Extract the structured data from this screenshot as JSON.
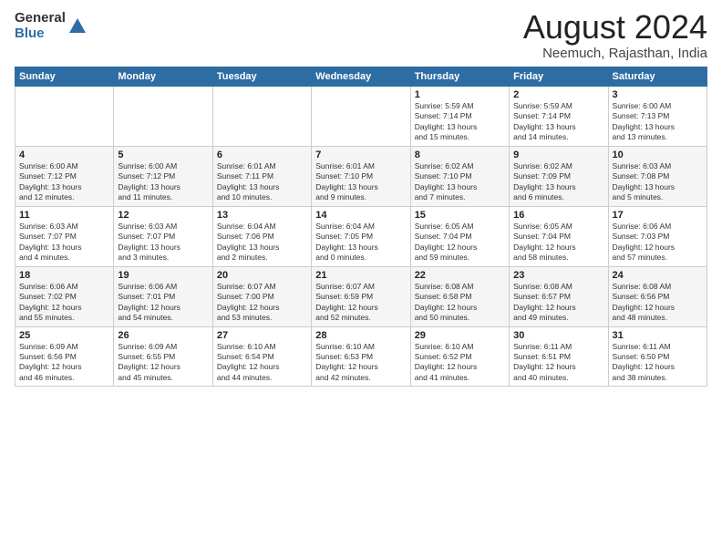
{
  "header": {
    "logo_general": "General",
    "logo_blue": "Blue",
    "month_title": "August 2024",
    "location": "Neemuch, Rajasthan, India"
  },
  "days_of_week": [
    "Sunday",
    "Monday",
    "Tuesday",
    "Wednesday",
    "Thursday",
    "Friday",
    "Saturday"
  ],
  "weeks": [
    [
      {
        "day": "",
        "info": ""
      },
      {
        "day": "",
        "info": ""
      },
      {
        "day": "",
        "info": ""
      },
      {
        "day": "",
        "info": ""
      },
      {
        "day": "1",
        "info": "Sunrise: 5:59 AM\nSunset: 7:14 PM\nDaylight: 13 hours\nand 15 minutes."
      },
      {
        "day": "2",
        "info": "Sunrise: 5:59 AM\nSunset: 7:14 PM\nDaylight: 13 hours\nand 14 minutes."
      },
      {
        "day": "3",
        "info": "Sunrise: 6:00 AM\nSunset: 7:13 PM\nDaylight: 13 hours\nand 13 minutes."
      }
    ],
    [
      {
        "day": "4",
        "info": "Sunrise: 6:00 AM\nSunset: 7:12 PM\nDaylight: 13 hours\nand 12 minutes."
      },
      {
        "day": "5",
        "info": "Sunrise: 6:00 AM\nSunset: 7:12 PM\nDaylight: 13 hours\nand 11 minutes."
      },
      {
        "day": "6",
        "info": "Sunrise: 6:01 AM\nSunset: 7:11 PM\nDaylight: 13 hours\nand 10 minutes."
      },
      {
        "day": "7",
        "info": "Sunrise: 6:01 AM\nSunset: 7:10 PM\nDaylight: 13 hours\nand 9 minutes."
      },
      {
        "day": "8",
        "info": "Sunrise: 6:02 AM\nSunset: 7:10 PM\nDaylight: 13 hours\nand 7 minutes."
      },
      {
        "day": "9",
        "info": "Sunrise: 6:02 AM\nSunset: 7:09 PM\nDaylight: 13 hours\nand 6 minutes."
      },
      {
        "day": "10",
        "info": "Sunrise: 6:03 AM\nSunset: 7:08 PM\nDaylight: 13 hours\nand 5 minutes."
      }
    ],
    [
      {
        "day": "11",
        "info": "Sunrise: 6:03 AM\nSunset: 7:07 PM\nDaylight: 13 hours\nand 4 minutes."
      },
      {
        "day": "12",
        "info": "Sunrise: 6:03 AM\nSunset: 7:07 PM\nDaylight: 13 hours\nand 3 minutes."
      },
      {
        "day": "13",
        "info": "Sunrise: 6:04 AM\nSunset: 7:06 PM\nDaylight: 13 hours\nand 2 minutes."
      },
      {
        "day": "14",
        "info": "Sunrise: 6:04 AM\nSunset: 7:05 PM\nDaylight: 13 hours\nand 0 minutes."
      },
      {
        "day": "15",
        "info": "Sunrise: 6:05 AM\nSunset: 7:04 PM\nDaylight: 12 hours\nand 59 minutes."
      },
      {
        "day": "16",
        "info": "Sunrise: 6:05 AM\nSunset: 7:04 PM\nDaylight: 12 hours\nand 58 minutes."
      },
      {
        "day": "17",
        "info": "Sunrise: 6:06 AM\nSunset: 7:03 PM\nDaylight: 12 hours\nand 57 minutes."
      }
    ],
    [
      {
        "day": "18",
        "info": "Sunrise: 6:06 AM\nSunset: 7:02 PM\nDaylight: 12 hours\nand 55 minutes."
      },
      {
        "day": "19",
        "info": "Sunrise: 6:06 AM\nSunset: 7:01 PM\nDaylight: 12 hours\nand 54 minutes."
      },
      {
        "day": "20",
        "info": "Sunrise: 6:07 AM\nSunset: 7:00 PM\nDaylight: 12 hours\nand 53 minutes."
      },
      {
        "day": "21",
        "info": "Sunrise: 6:07 AM\nSunset: 6:59 PM\nDaylight: 12 hours\nand 52 minutes."
      },
      {
        "day": "22",
        "info": "Sunrise: 6:08 AM\nSunset: 6:58 PM\nDaylight: 12 hours\nand 50 minutes."
      },
      {
        "day": "23",
        "info": "Sunrise: 6:08 AM\nSunset: 6:57 PM\nDaylight: 12 hours\nand 49 minutes."
      },
      {
        "day": "24",
        "info": "Sunrise: 6:08 AM\nSunset: 6:56 PM\nDaylight: 12 hours\nand 48 minutes."
      }
    ],
    [
      {
        "day": "25",
        "info": "Sunrise: 6:09 AM\nSunset: 6:56 PM\nDaylight: 12 hours\nand 46 minutes."
      },
      {
        "day": "26",
        "info": "Sunrise: 6:09 AM\nSunset: 6:55 PM\nDaylight: 12 hours\nand 45 minutes."
      },
      {
        "day": "27",
        "info": "Sunrise: 6:10 AM\nSunset: 6:54 PM\nDaylight: 12 hours\nand 44 minutes."
      },
      {
        "day": "28",
        "info": "Sunrise: 6:10 AM\nSunset: 6:53 PM\nDaylight: 12 hours\nand 42 minutes."
      },
      {
        "day": "29",
        "info": "Sunrise: 6:10 AM\nSunset: 6:52 PM\nDaylight: 12 hours\nand 41 minutes."
      },
      {
        "day": "30",
        "info": "Sunrise: 6:11 AM\nSunset: 6:51 PM\nDaylight: 12 hours\nand 40 minutes."
      },
      {
        "day": "31",
        "info": "Sunrise: 6:11 AM\nSunset: 6:50 PM\nDaylight: 12 hours\nand 38 minutes."
      }
    ]
  ]
}
